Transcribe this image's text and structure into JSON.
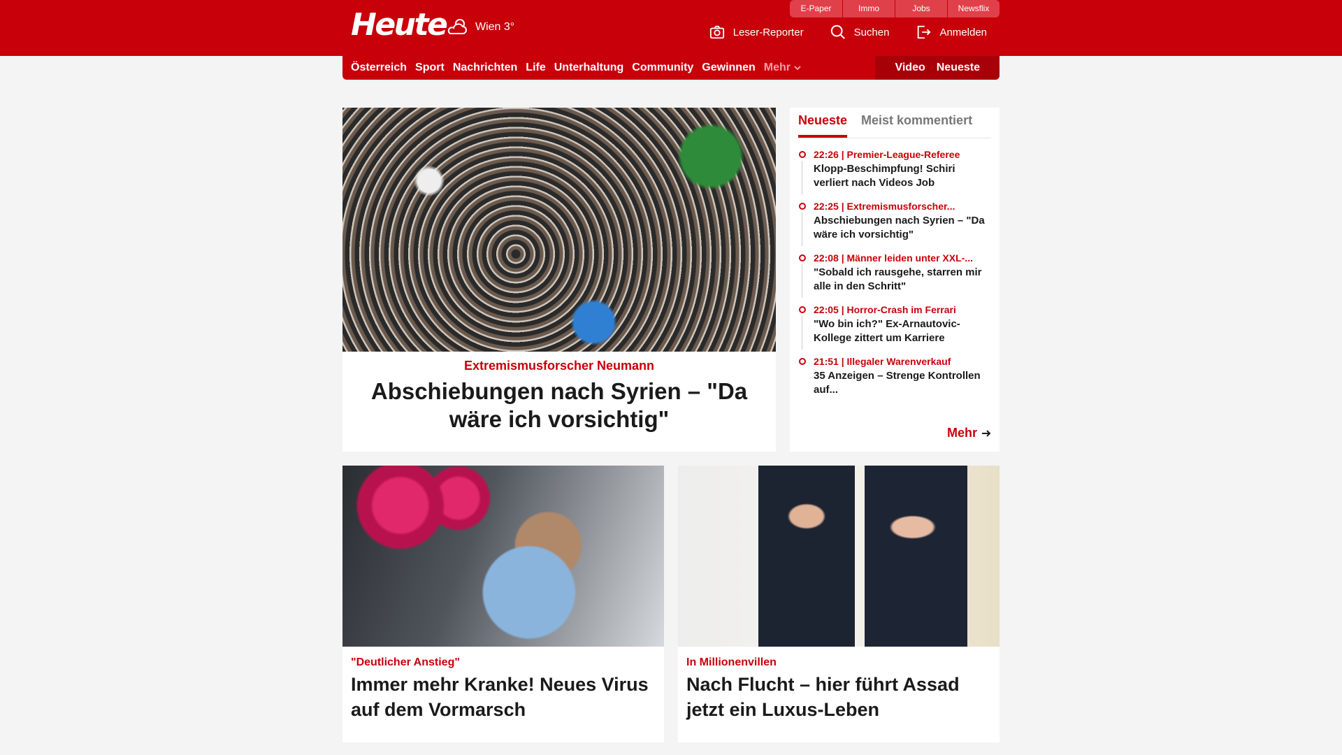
{
  "header": {
    "logo": "Heute",
    "weather": {
      "icon": "cloud-sun-icon",
      "text": "Wien 3°"
    },
    "services": [
      "E-Paper",
      "Immo",
      "Jobs",
      "Newsflix"
    ],
    "actions": [
      {
        "icon": "camera-icon",
        "label": "Leser-Reporter"
      },
      {
        "icon": "search-icon",
        "label": "Suchen"
      },
      {
        "icon": "login-icon",
        "label": "Anmelden"
      }
    ],
    "brand_color": "#c8000a"
  },
  "nav": {
    "items": [
      "Österreich",
      "Sport",
      "Nachrichten",
      "Life",
      "Unterhaltung",
      "Community",
      "Gewinnen"
    ],
    "more_label": "Mehr",
    "right_items": [
      "Video",
      "Neueste"
    ]
  },
  "hero": {
    "kicker": "Extremismusforscher Neumann",
    "title": "Abschiebungen nach Syrien – \"Da wäre ich vorsichtig\""
  },
  "sidebar": {
    "tabs": [
      "Neueste",
      "Meist kommentiert"
    ],
    "active_tab": "Neueste",
    "items": [
      {
        "meta": "22:26 | Premier-League-Referee",
        "title": "Klopp-Beschimpfung! Schiri verliert nach Videos Job"
      },
      {
        "meta": "22:25 | Extremismusforscher...",
        "title": "Abschiebungen nach Syrien – \"Da wäre ich vorsichtig\""
      },
      {
        "meta": "22:08 | Männer leiden unter XXL-...",
        "title": "\"Sobald ich rausgehe, starren mir alle in den Schritt\""
      },
      {
        "meta": "22:05 | Horror-Crash im Ferrari",
        "title": "\"Wo bin ich?\" Ex-Arnautovic-Kollege zittert um Karriere"
      },
      {
        "meta": "21:51 | Illegaler Warenverkauf",
        "title": "35 Anzeigen – Strenge Kontrollen auf..."
      }
    ],
    "more_label": "Mehr"
  },
  "cards": [
    {
      "kicker": "\"Deutlicher Anstieg\"",
      "title": "Immer mehr Kranke! Neues Virus auf dem Vormarsch"
    },
    {
      "kicker": "In Millionenvillen",
      "title": "Nach Flucht – hier führt Assad jetzt ein Luxus-Leben"
    }
  ]
}
